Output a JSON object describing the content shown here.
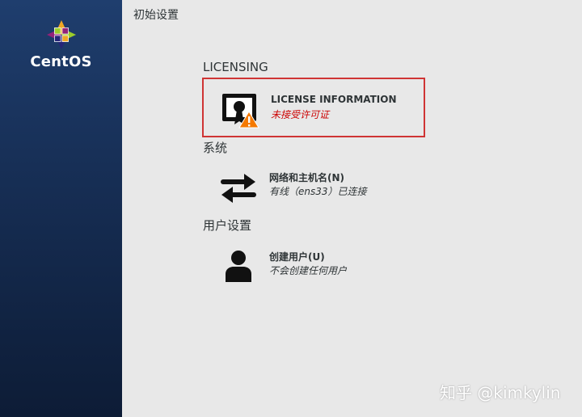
{
  "brand": {
    "logo_text": "CentOS"
  },
  "page": {
    "title": "初始设置"
  },
  "sections": [
    {
      "header": "LICENSING",
      "spokes": [
        {
          "title": "LICENSE INFORMATION",
          "status": "未接受许可证",
          "icon": "license-warning-icon",
          "warning": true
        }
      ]
    },
    {
      "header": "系统",
      "spokes": [
        {
          "title": "网络和主机名(N)",
          "status": "有线（ens33）已连接",
          "icon": "network-arrows-icon",
          "warning": false
        }
      ]
    },
    {
      "header": "用户设置",
      "spokes": [
        {
          "title": "创建用户(U)",
          "status": "不会创建任何用户",
          "icon": "user-icon",
          "warning": false
        }
      ]
    }
  ],
  "watermark": "知乎 @kimkylin",
  "colors": {
    "sidebar": "#1f3e6e",
    "highlight_border": "#cf3434",
    "warning_text": "#cc0000",
    "warning_triangle": "#f57900"
  }
}
